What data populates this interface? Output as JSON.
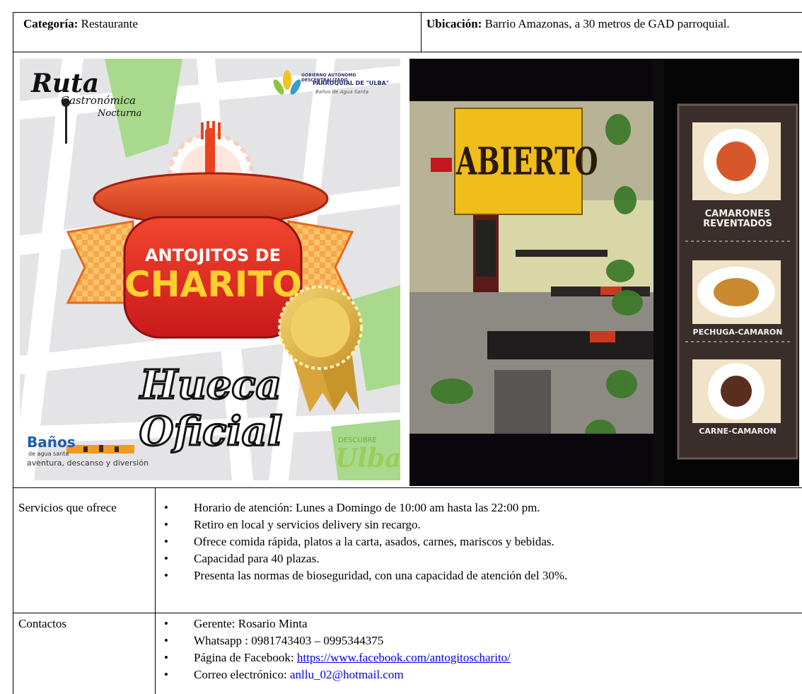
{
  "header": {
    "category_label": "Categoría:",
    "category_value": "Restaurante",
    "location_label": "Ubicación:",
    "location_value": "Barrio Amazonas, a 30 metros de GAD parroquial."
  },
  "poster": {
    "ruta_title": "Ruta",
    "ruta_sub1": "Gastronómica",
    "ruta_sub2": "Nocturna",
    "gad_line1": "GOBIERNO AUTÓNOMO DESCENTRALIZADO",
    "gad_line2": "PARROQUIAL DE \"ULBA\"",
    "gad_line3": "Baños de Agua Santa",
    "brand_line1": "ANTOJITOS DE",
    "brand_line2": "CHARITO",
    "hueca": "Hueca Oficial",
    "banos_title": "Baños",
    "banos_sub": "de agua santa",
    "banos_tagline": "aventura, descanso y diversión",
    "descubre": "DESCUBRE",
    "ulba": "Ulba"
  },
  "photo": {
    "sign": "ABIERTO",
    "menu": [
      "CAMARONES",
      "REVENTADOS",
      "PECHUGA-CAMARON",
      "CARNE-CAMARON"
    ]
  },
  "services": {
    "label": "Servicios que ofrece",
    "items": [
      "Horario de atención: Lunes a Domingo de 10:00 am hasta las 22:00 pm.",
      "Retiro en local y servicios delivery sin recargo.",
      "Ofrece comida rápida, platos a la carta, asados, carnes, mariscos y bebidas.",
      "Capacidad para 40 plazas.",
      "Presenta las normas de bioseguridad, con una capacidad de atención del 30%."
    ]
  },
  "contacts": {
    "label": "Contactos",
    "manager": "Gerente: Rosario Minta",
    "whatsapp": "Whatsapp : 0981743403 – 0995344375",
    "facebook_label": "Página de Facebook: ",
    "facebook_url": "https://www.facebook.com/antogitoscharito/",
    "email_label": "Correo electrónico: ",
    "email": "anllu_02@hotmail.com"
  }
}
